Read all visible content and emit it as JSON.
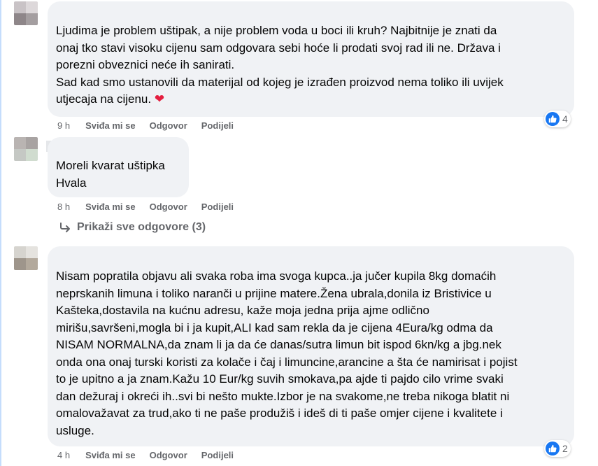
{
  "comments": [
    {
      "text_lines": [
        "Ljudima je problem uštipak, a nije problem voda u boci ili kruh? Najbitnije je znati da",
        "onaj tko stavi visoku cijenu sam odgovara sebi hoće li prodati svoj rad ili ne. Država i",
        "porezni obveznici neće ih sanirati.",
        "Sad kad smo ustanovili da materijal od kojeg je izrađen proizvod nema toliko ili uvijek",
        "utjecaja na cijenu."
      ],
      "emoji": "❤",
      "time": "9 h",
      "like_label": "Sviđa mi se",
      "reply_label": "Odgovor",
      "share_label": "Podijeli",
      "reaction_count": "4"
    },
    {
      "text_lines": [
        "Moreli kvarat uštipka",
        "Hvala"
      ],
      "time": "8 h",
      "like_label": "Sviđa mi se",
      "reply_label": "Odgovor",
      "share_label": "Podijeli"
    },
    {
      "text_lines": [
        "Nisam popratila objavu ali svaka roba ima svoga kupca..ja jučer kupila 8kg domaćih",
        "neprskanih limuna i toliko naranči u prijine matere.Žena ubrala,donila iz Bristivice u",
        "Kašteka,dostavila na kućnu adresu, kaže moja jedna prija ajme odlično",
        "mirišu,savršeni,mogla bi i ja kupit,ALI kad sam rekla da je cijena 4Eura/kg odma da",
        "NISAM NORMALNA,da znam li ja da će danas/sutra limun bit ispod 6kn/kg a jbg.nek",
        "onda ona onaj turski koristi za kolače i čaj i limuncine,arancine a šta će namirisat i pojist",
        "to je upitno a ja znam.Kažu 10 Eur/kg suvih smokava,pa ajde ti pajdo cilo vrime svaki",
        "dan dežuraj i okreći ih..svi bi nešto mukte.Izbor je na svakome,ne treba nikoga blatit ni",
        "omalovažavat za trud,ako ti ne paše produžiš i ideš di ti paše omjer cijene i kvalitete i",
        "usluge."
      ],
      "time": "4 h",
      "like_label": "Sviđa mi se",
      "reply_label": "Odgovor",
      "share_label": "Podijeli",
      "reaction_count": "2"
    }
  ],
  "view_replies": {
    "label": "Prikaži sve odgovore (3)",
    "icon": "reply-arrow-icon"
  },
  "colors": {
    "bubble": "#f0f2f5",
    "meta_text": "#65676b",
    "like_blue": "#1877f2",
    "heart": "#e41e3f"
  }
}
